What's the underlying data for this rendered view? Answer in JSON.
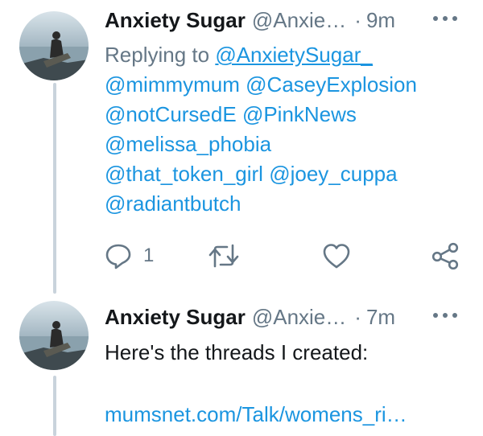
{
  "tweets": [
    {
      "name": "Anxiety Sugar",
      "handle": "@Anxie…",
      "dot": "·",
      "time": "9m",
      "replying_prefix": "Replying to",
      "mentions": [
        "@AnxietySugar_",
        "@mimmymum",
        "@CaseyExplosion",
        "@notCursedE",
        "@PinkNews",
        "@melissa_phobia",
        "@that_token_girl",
        "@joey_cuppa",
        "@radiantbutch"
      ],
      "reply_count": "1"
    },
    {
      "name": "Anxiety Sugar",
      "handle": "@Anxie…",
      "dot": "·",
      "time": "7m",
      "text": "Here's the threads I created:",
      "link": "mumsnet.com/Talk/womens_ri…"
    }
  ],
  "colors": {
    "accent": "#1b95e0",
    "muted": "#657786",
    "text": "#14171a",
    "thread_line": "#c9d3dc"
  },
  "icons": [
    "more-icon",
    "reply-icon",
    "retweet-icon",
    "like-icon",
    "share-icon"
  ]
}
